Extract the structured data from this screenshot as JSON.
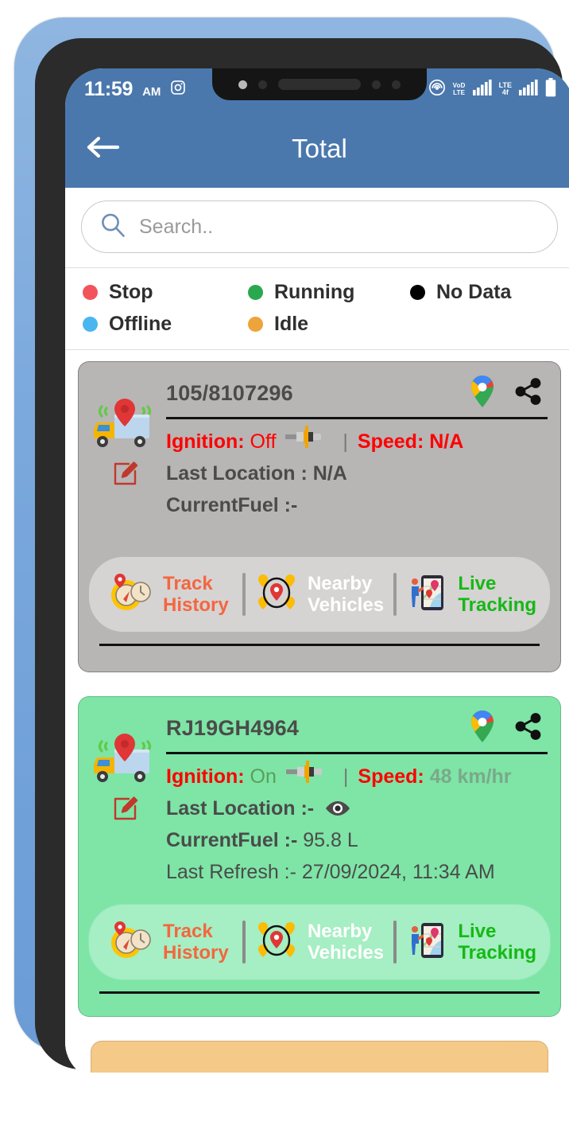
{
  "status_bar": {
    "time": "11:59",
    "ampm": "AM",
    "app_icon": "instagram-icon",
    "hotspot_icon": "cast-hotspot-icon",
    "volte_line1": "VoD",
    "volte_line2": "LTE",
    "network_label": "LTE",
    "battery_icon": "battery-icon"
  },
  "app_bar": {
    "back_icon": "back-arrow-icon",
    "title": "Total"
  },
  "search": {
    "icon": "search-icon",
    "placeholder": "Search..",
    "value": ""
  },
  "legend": {
    "items": [
      {
        "label": "Stop",
        "color": "#f2545b"
      },
      {
        "label": "Running",
        "color": "#2aa84f"
      },
      {
        "label": "No Data",
        "color": "#000000"
      },
      {
        "label": "Offline",
        "color": "#49b6f0"
      },
      {
        "label": "Idle",
        "color": "#eda43a"
      }
    ]
  },
  "action_labels": {
    "track_history_line1": "Track",
    "track_history_line2": "History",
    "nearby_line1": "Nearby",
    "nearby_line2": "Vehicles",
    "live_line1": "Live",
    "live_line2": "Tracking",
    "track_history_color": "#f4663f",
    "nearby_color": "#ffffff",
    "live_color": "#16b816"
  },
  "vehicles": [
    {
      "plate": "105/8107296",
      "status": "no-data",
      "card_color": "#b8b5b5",
      "ignition_label": "Ignition:",
      "ignition_value": "Off",
      "speed_label": "Speed:",
      "speed_value": "N/A",
      "last_location_label": "Last Location : N/A",
      "fuel_label": "CurrentFuel :-",
      "fuel_value": "",
      "last_refresh": "",
      "maps_icon": "google-maps-pin-icon",
      "share_icon": "share-icon",
      "edit_icon": "edit-pencil-icon",
      "vehicle_icon": "delivery-truck-tracker-icon",
      "spark_icon": "spark-plug-icon",
      "eye_icon": ""
    },
    {
      "plate": "RJ19GH4964",
      "status": "running",
      "card_color": "#7ee5a6",
      "ignition_label": "Ignition:",
      "ignition_value": "On",
      "speed_label": "Speed:",
      "speed_value": "48 km/hr",
      "last_location_label": "Last Location :-",
      "fuel_label": "CurrentFuel :-",
      "fuel_value": "95.8 L",
      "last_refresh": "Last Refresh :- 27/09/2024, 11:34 AM",
      "maps_icon": "google-maps-pin-icon",
      "share_icon": "share-icon",
      "edit_icon": "edit-pencil-icon",
      "vehicle_icon": "delivery-truck-tracker-icon",
      "spark_icon": "spark-plug-icon",
      "eye_icon": "eye-icon"
    }
  ],
  "theme": {
    "header_blue": "#4a78ad",
    "gray_card": "#b8b5b5",
    "green_card": "#7ee5a6",
    "orange_card": "#f5c987"
  }
}
